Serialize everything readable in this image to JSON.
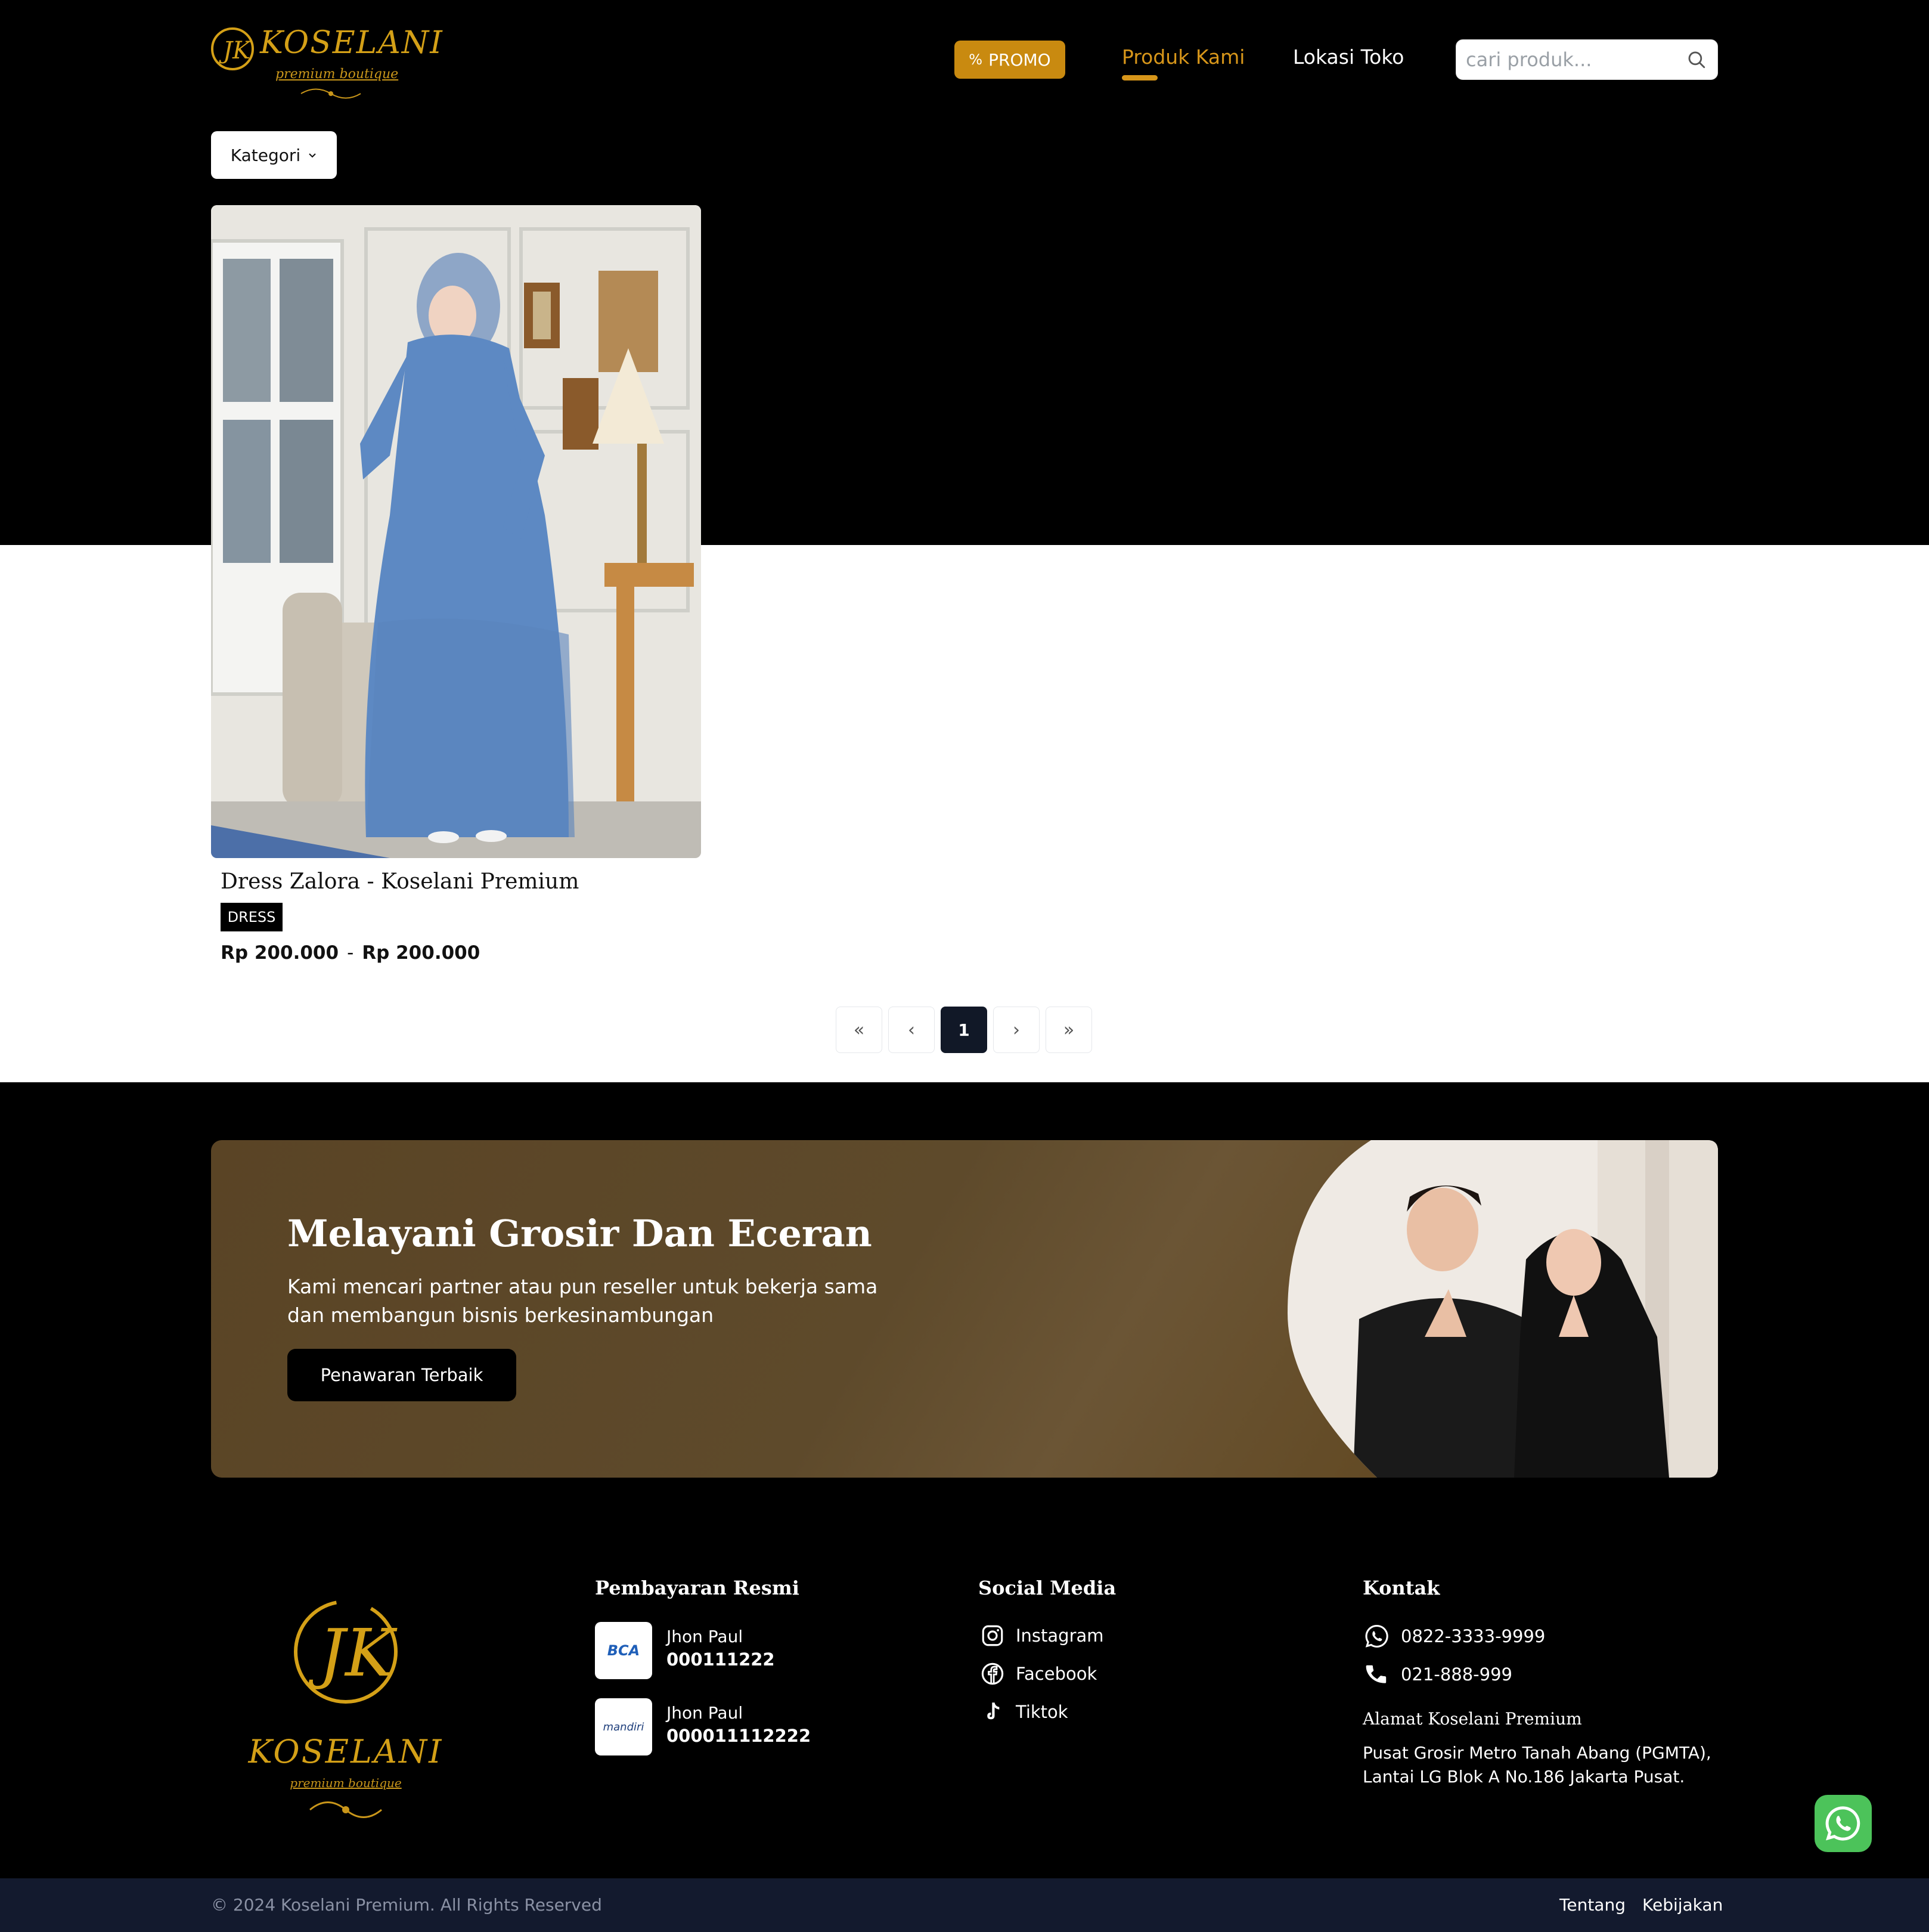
{
  "header": {
    "logo_text": "KOSELANI",
    "logo_subtitle": "premium boutique",
    "promo_label": "PROMO",
    "nav_produk": "Produk Kami",
    "nav_lokasi": "Lokasi Toko",
    "search_placeholder": "cari produk..."
  },
  "filter": {
    "kategori_label": "Kategori"
  },
  "product": {
    "title": "Dress Zalora - Koselani Premium",
    "badge": "DRESS",
    "price_min": "Rp 200.000",
    "price_sep": "-",
    "price_max": "Rp 200.000"
  },
  "pagination": {
    "first": "«",
    "prev": "‹",
    "current": "1",
    "next": "›",
    "last": "»"
  },
  "banner": {
    "title": "Melayani Grosir Dan Eceran",
    "description": "Kami mencari partner atau pun reseller untuk bekerja sama dan membangun bisnis berkesinambungan",
    "button": "Penawaran Terbaik"
  },
  "footer": {
    "payment_title": "Pembayaran Resmi",
    "payments": [
      {
        "bank": "BCA",
        "name": "Jhon Paul",
        "number": "000111222"
      },
      {
        "bank": "mandiri",
        "name": "Jhon Paul",
        "number": "000011112222"
      }
    ],
    "social_title": "Social Media",
    "social": [
      "Instagram",
      "Facebook",
      "Tiktok"
    ],
    "contact_title": "Kontak",
    "whatsapp": "0822-3333-9999",
    "phone": "021-888-999",
    "address_title": "Alamat Koselani Premium",
    "address": "Pusat Grosir Metro Tanah Abang (PGMTA), Lantai LG Blok A No.186 Jakarta Pusat."
  },
  "bottom": {
    "copyright": "© 2024 Koselani Premium. All Rights Reserved",
    "tentang": "Tentang",
    "kebijakan": "Kebijakan"
  },
  "colors": {
    "accent": "#c98a10",
    "nav_active": "#d7961a",
    "bottom_bar": "#131a2e",
    "whatsapp": "#4cc35a"
  }
}
